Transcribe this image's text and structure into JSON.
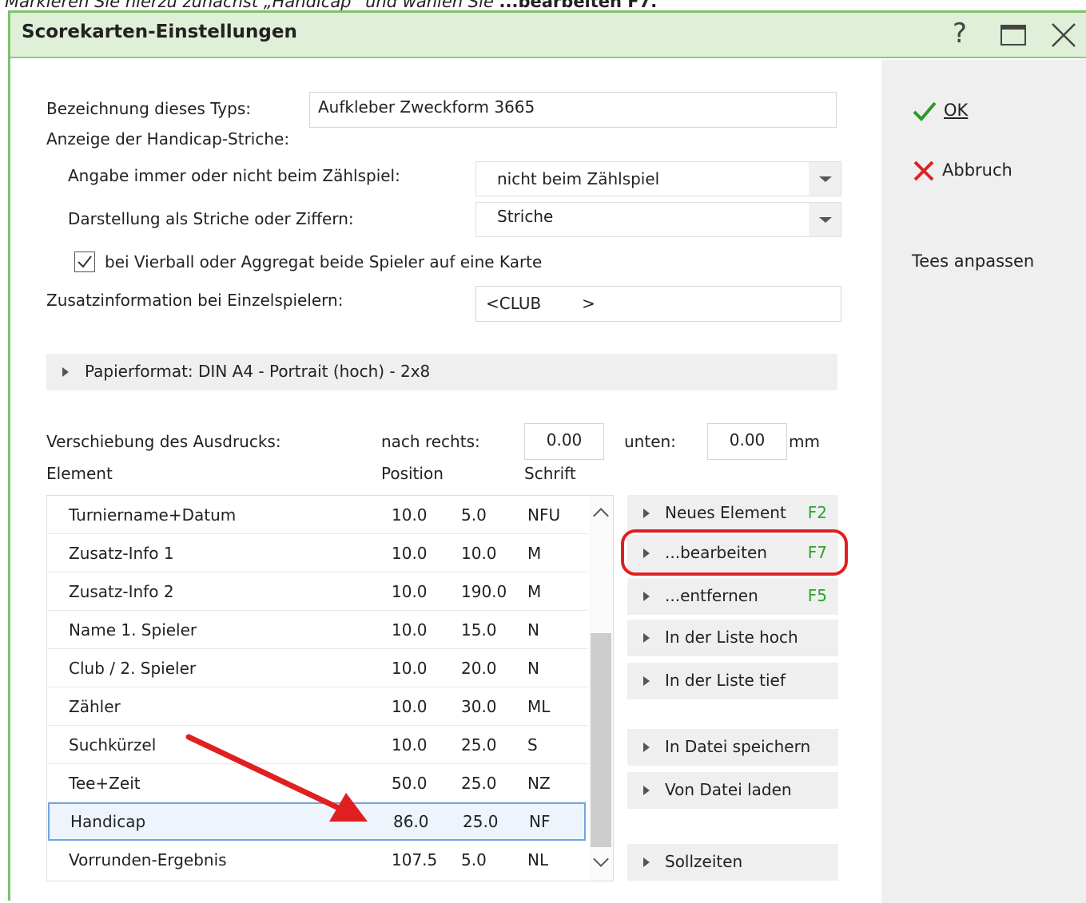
{
  "caption": {
    "prefix": "Markieren Sie hierzu zunächst „Handicap“ und wählen Sie ",
    "bold": "...bearbeiten F7."
  },
  "window": {
    "title": "Scorekarten-Einstellungen",
    "help_label": "?"
  },
  "side": {
    "ok_label": "OK",
    "cancel_label": "Abbruch",
    "tees_label": "Tees anpassen"
  },
  "form": {
    "type_label": "Bezeichnung dieses Typs:",
    "type_value": "Aufkleber Zweckform 3665",
    "hcp_strokes_label": "Anzeige der Handicap-Striche:",
    "always_label": "Angabe immer oder nicht beim Zählspiel:",
    "always_value": "nicht beim Zählspiel",
    "display_label": "Darstellung als Striche oder Ziffern:",
    "display_value": "Striche",
    "fourball_checked": true,
    "fourball_label": "bei Vierball oder Aggregat beide Spieler auf eine Karte",
    "extra_label": "Zusatzinformation bei Einzelspielern:",
    "extra_value": "<CLUB        >",
    "paper_label": "Papierformat: DIN A4 - Portrait (hoch) - 2x8",
    "shift_label": "Verschiebung des Ausdrucks:",
    "right_label": "nach rechts:",
    "right_value": "0.00",
    "down_label": "unten:",
    "down_value": "0.00",
    "unit": "mm"
  },
  "table": {
    "headers": {
      "element": "Element",
      "position": "Position",
      "font": "Schrift"
    },
    "rows": [
      {
        "name": "Turniername+Datum",
        "x": "10.0",
        "y": "5.0",
        "font": "NFU"
      },
      {
        "name": "Zusatz-Info 1",
        "x": "10.0",
        "y": "10.0",
        "font": "M"
      },
      {
        "name": "Zusatz-Info 2",
        "x": "10.0",
        "y": "190.0",
        "font": "M"
      },
      {
        "name": "Name 1. Spieler",
        "x": "10.0",
        "y": "15.0",
        "font": "N"
      },
      {
        "name": "Club / 2. Spieler",
        "x": "10.0",
        "y": "20.0",
        "font": "N"
      },
      {
        "name": "Zähler",
        "x": "10.0",
        "y": "30.0",
        "font": "ML"
      },
      {
        "name": "Suchkürzel",
        "x": "10.0",
        "y": "25.0",
        "font": "S"
      },
      {
        "name": "Tee+Zeit",
        "x": "50.0",
        "y": "25.0",
        "font": "NZ"
      },
      {
        "name": "Handicap",
        "x": "86.0",
        "y": "25.0",
        "font": "NF"
      },
      {
        "name": "Vorrunden-Ergebnis",
        "x": "107.5",
        "y": "5.0",
        "font": "NL"
      }
    ],
    "selected_row": "Handicap"
  },
  "actions": [
    {
      "label": "Neues Element",
      "key": "F2"
    },
    {
      "label": "...bearbeiten",
      "key": "F7"
    },
    {
      "label": "...entfernen",
      "key": "F5"
    },
    {
      "label": "In der Liste hoch",
      "key": ""
    },
    {
      "label": "In der Liste tief",
      "key": ""
    },
    {
      "label": "In Datei speichern",
      "key": ""
    },
    {
      "label": "Von Datei laden",
      "key": ""
    },
    {
      "label": "Sollzeiten",
      "key": ""
    }
  ],
  "colors": {
    "titlebar": "#e0f0d8",
    "accent_green": "#7cc36a",
    "shortcut_green": "#2aa52a",
    "highlight_red": "#e02020",
    "arrow_red": "#e02020"
  },
  "icons": [
    "help-icon",
    "maximize-icon",
    "close-icon",
    "checkmark-icon",
    "cross-icon",
    "expand-triangle-icon",
    "scroll-up-icon",
    "scroll-down-icon"
  ]
}
